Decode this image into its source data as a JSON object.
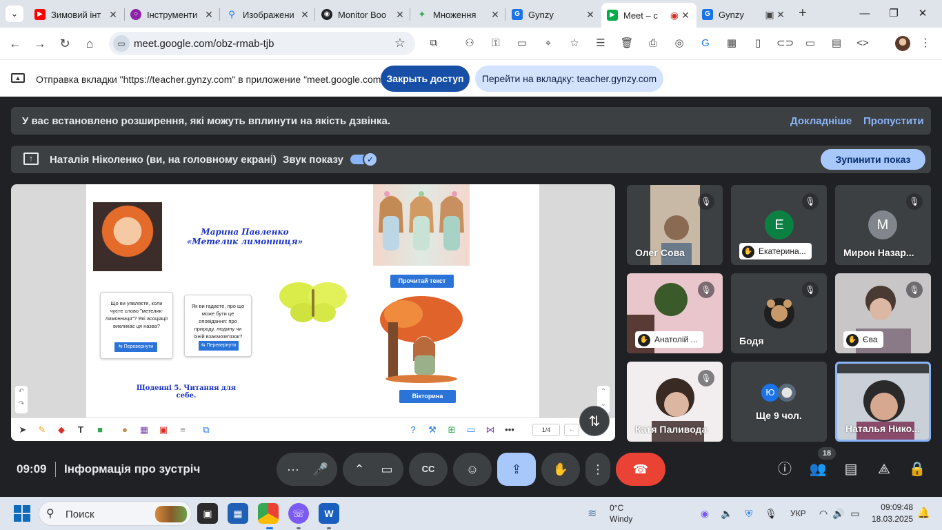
{
  "browser": {
    "tabs": [
      {
        "label": "Зимовий інт",
        "icon": "youtube-icon",
        "color": "#ff0000"
      },
      {
        "label": "Інструменти",
        "icon": "app-icon",
        "color": "#8e24aa"
      },
      {
        "label": "Изображени",
        "icon": "search-icon",
        "color": "#1a73e8"
      },
      {
        "label": "Monitor Boo",
        "icon": "app-icon",
        "color": "#202124"
      },
      {
        "label": "Множення",
        "icon": "app-icon",
        "color": "#34a853"
      },
      {
        "label": "Gynzy",
        "icon": "gynzy-icon",
        "color": "#1a73e8"
      },
      {
        "label": "Meet – с",
        "icon": "meet-icon",
        "color": "#00ac47"
      },
      {
        "label": "Gynzy",
        "icon": "gynzy-icon",
        "color": "#1a73e8"
      }
    ],
    "url": "meet.google.com/obz-rmab-tjb"
  },
  "infobar": {
    "message": "Отправка вкладки \"https://teacher.gynzy.com\" в приложение \"meet.google.com\"...",
    "close_access": "Закрыть доступ",
    "go_to_tab": "Перейти на вкладку: teacher.gynzy.com"
  },
  "meet": {
    "ext_warning": "У вас встановлено розширення, які можуть вплинути на якість дзвінка.",
    "learn_more": "Докладніше",
    "skip": "Пропустити",
    "presenter": "Наталія Ніколенко (ви, на головному екрані)",
    "sound_label": "Звук показу",
    "stop_sharing": "Зупинити показ",
    "slide": {
      "author": "Марина Павленко",
      "title": "«Метелик лимонниця»",
      "question1": "Що ви уявляєте, коли чуєте слово \"метелик-лимонниця\"? Які асоціації викликає ця назва?",
      "question2": "Як ви гадаєте, про що може бути це оповідання: про природу, людину чи їхній взаємозв'язок?",
      "flip": "⇆ Перевернути",
      "read_text": "Прочитай текст",
      "quiz": "Вікторина",
      "footer": "Щоденні 5. Читання для себе.",
      "page": "1/4"
    },
    "participants": [
      {
        "name": "Олег Сова"
      },
      {
        "name": "Екатерина...",
        "initial": "Е",
        "color": "#0b8043"
      },
      {
        "name": "Мирон Назар...",
        "initial": "М",
        "color": "#80868b"
      },
      {
        "name": "Анатолій ..."
      },
      {
        "name": "Бодя"
      },
      {
        "name": "Єва"
      },
      {
        "name": "Катя Паливода"
      },
      {
        "name": "Ще 9 чол.",
        "initial": "Ю",
        "color": "#1a73e8"
      },
      {
        "name": "Наталья Нико..."
      }
    ],
    "time": "09:09",
    "meeting_info": "Інформація про зустріч",
    "participant_count": "18"
  },
  "taskbar": {
    "search": "Поиск",
    "temperature": "0°C",
    "weather": "Windy",
    "lang": "УКР",
    "time": "09:09:48",
    "date": "18.03.2025"
  }
}
